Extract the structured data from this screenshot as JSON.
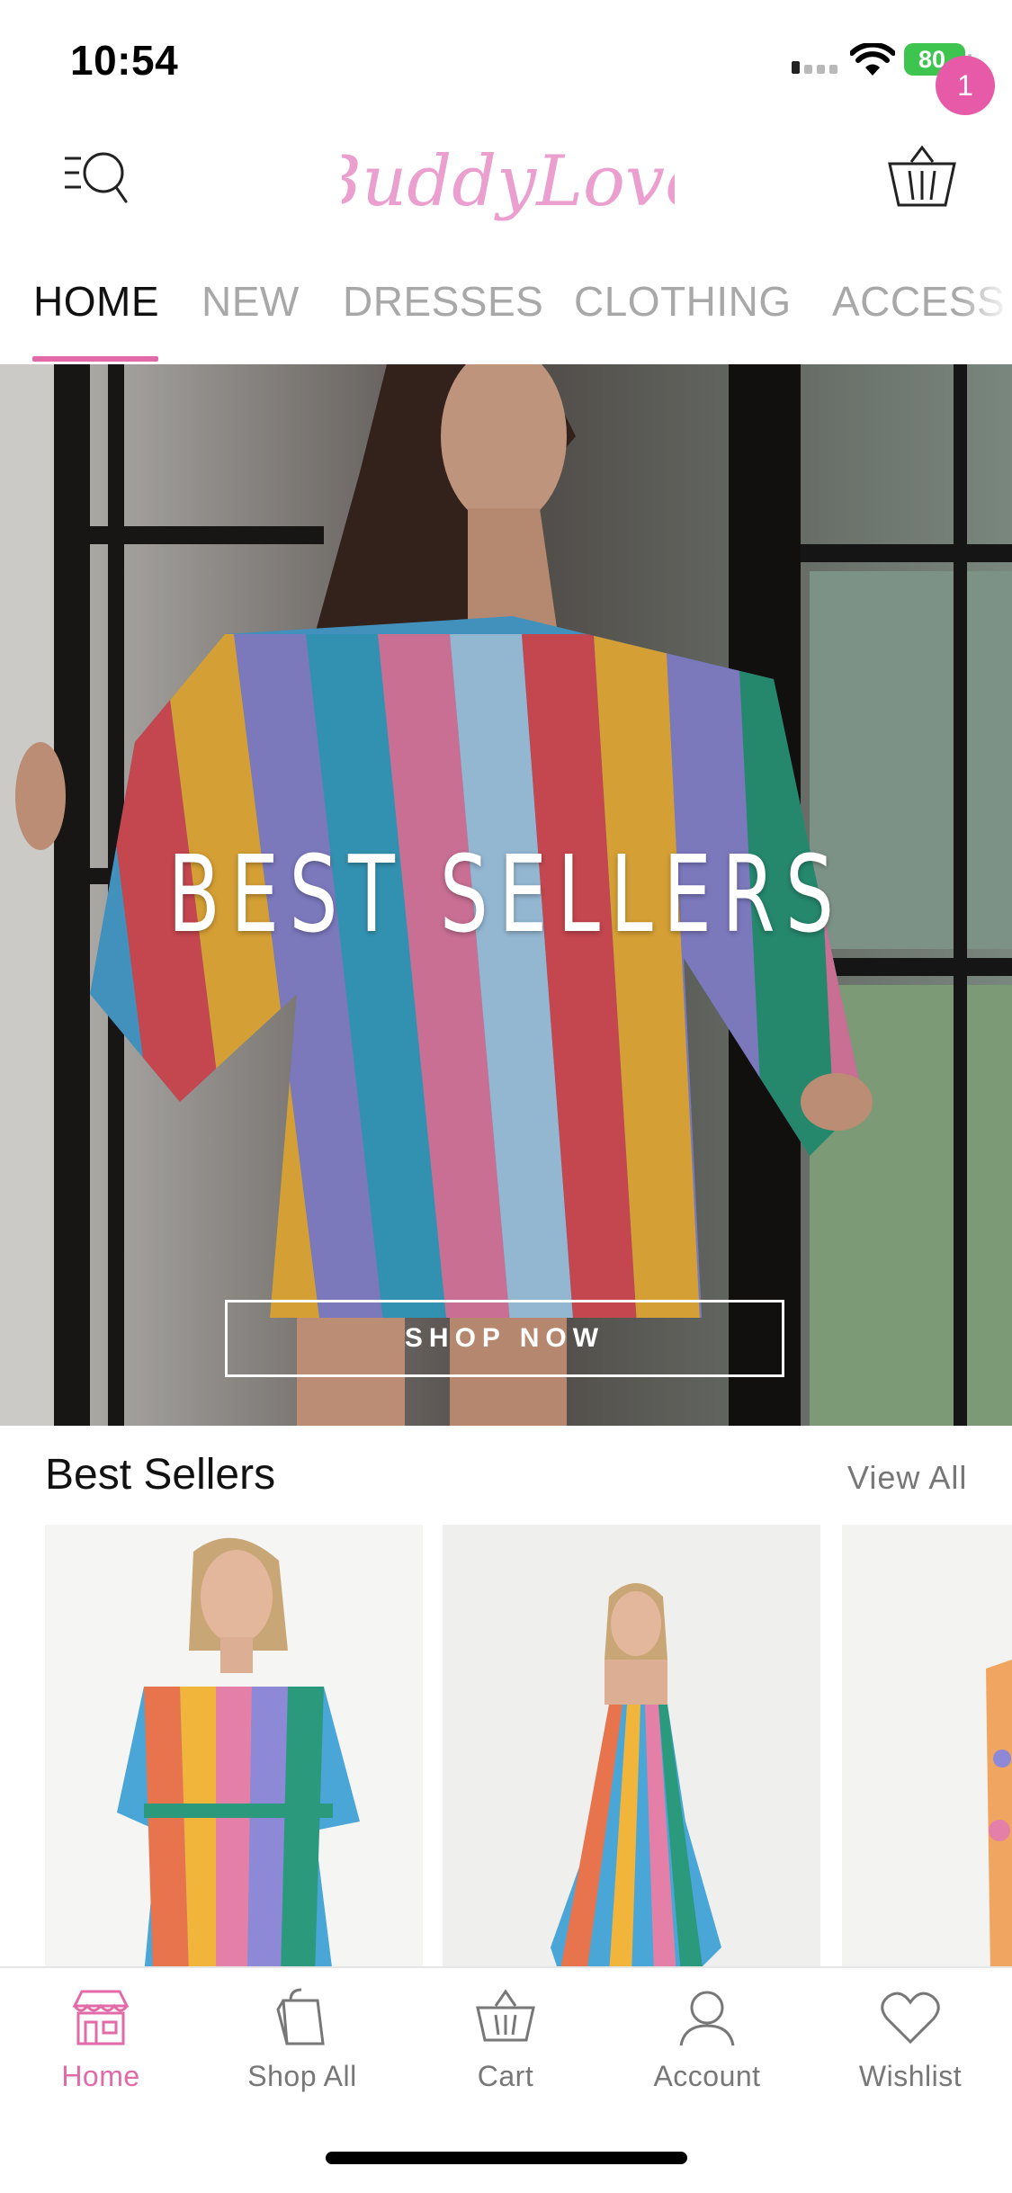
{
  "status_bar": {
    "time": "10:54",
    "battery": "80"
  },
  "header": {
    "logo_text": "BuddyLove",
    "cart_count": "1"
  },
  "tabs": [
    {
      "label": "HOME"
    },
    {
      "label": "NEW"
    },
    {
      "label": "DRESSES"
    },
    {
      "label": "CLOTHING"
    },
    {
      "label": "ACCESS"
    }
  ],
  "hero": {
    "title": "BEST SELLERS",
    "cta": "SHOP NOW"
  },
  "best_sellers": {
    "title": "Best Sellers",
    "view_all": "View All"
  },
  "bottom_nav": [
    {
      "label": "Home",
      "icon": "storefront-icon"
    },
    {
      "label": "Shop All",
      "icon": "shopping-bag-icon"
    },
    {
      "label": "Cart",
      "icon": "basket-icon"
    },
    {
      "label": "Account",
      "icon": "person-icon"
    },
    {
      "label": "Wishlist",
      "icon": "heart-icon"
    }
  ],
  "colors": {
    "accent": "#e26aa8",
    "badge": "#e65aa8",
    "logo": "#ea9fcf"
  }
}
